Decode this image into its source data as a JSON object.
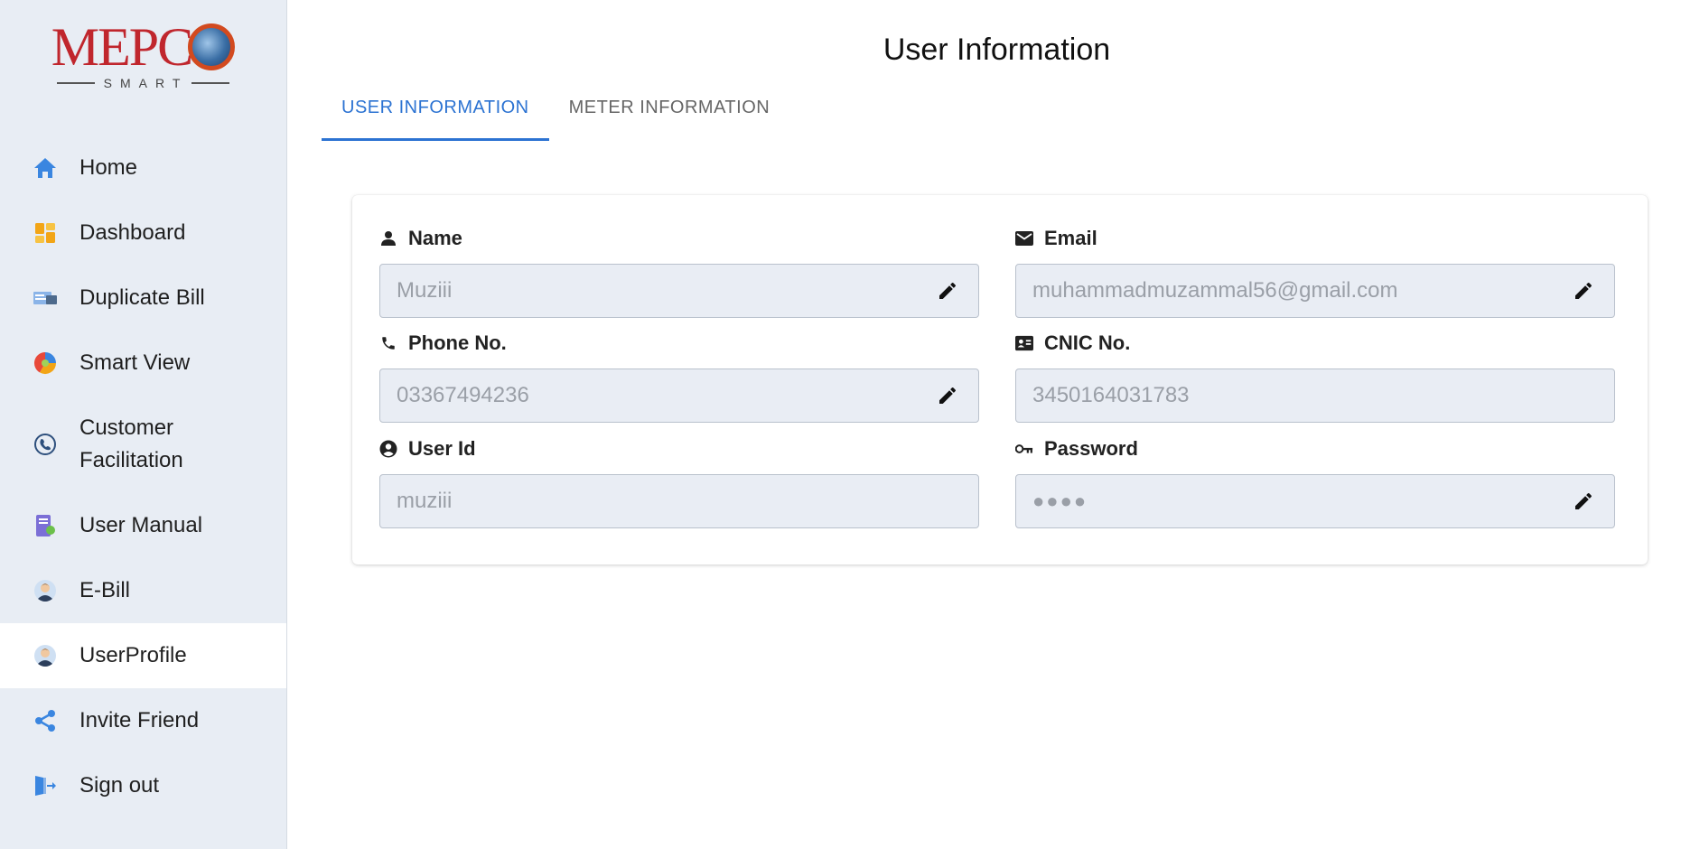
{
  "brand": {
    "logo_text": "MEPC",
    "logo_subtext": "SMART",
    "accent_color": "#c0262d"
  },
  "sidebar": {
    "items": [
      {
        "label": "Home",
        "icon": "home-icon"
      },
      {
        "label": "Dashboard",
        "icon": "dashboard-icon"
      },
      {
        "label": "Duplicate Bill",
        "icon": "bill-icon"
      },
      {
        "label": "Smart View",
        "icon": "pie-chart-icon"
      },
      {
        "label": "Customer Facilitation",
        "icon": "phone-support-icon"
      },
      {
        "label": "User Manual",
        "icon": "manual-icon"
      },
      {
        "label": "E-Bill",
        "icon": "user-avatar-icon"
      },
      {
        "label": "UserProfile",
        "icon": "user-avatar-icon",
        "active": true
      },
      {
        "label": "Invite Friend",
        "icon": "share-icon"
      },
      {
        "label": "Sign out",
        "icon": "sign-out-icon"
      }
    ]
  },
  "main": {
    "title": "User Information",
    "tabs": [
      {
        "label": "USER INFORMATION",
        "active": true
      },
      {
        "label": "METER INFORMATION",
        "active": false
      }
    ],
    "fields": {
      "name": {
        "label": "Name",
        "value": "Muziii",
        "editable": true
      },
      "email": {
        "label": "Email",
        "value": "muhammadmuzammal56@gmail.com",
        "editable": true
      },
      "phone": {
        "label": "Phone No.",
        "value": "03367494236",
        "editable": true
      },
      "cnic": {
        "label": "CNIC No.",
        "value": "3450164031783",
        "editable": false
      },
      "user_id": {
        "label": "User Id",
        "value": "muziii",
        "editable": false
      },
      "password": {
        "label": "Password",
        "value": "●●●●",
        "editable": true
      }
    }
  },
  "colors": {
    "sidebar_bg": "#e8edf4",
    "tab_active": "#2c73d2",
    "field_bg": "#e9edf4"
  }
}
